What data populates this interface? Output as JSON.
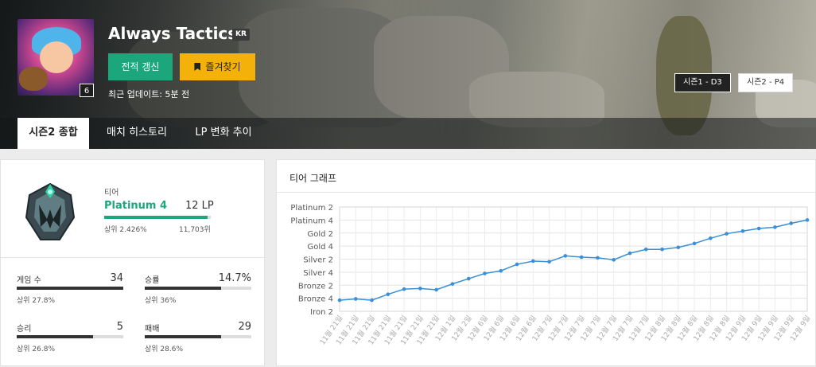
{
  "header": {
    "summoner_name": "Always Tactics",
    "region": "KR",
    "level": "6",
    "refresh_label": "전적 갱신",
    "favorite_label": "즐겨찾기",
    "last_update": "최근 업데이트: 5분 전",
    "season_chips": [
      "시즌1 - D3",
      "시즌2 - P4"
    ]
  },
  "tabs": [
    {
      "label": "시즌2 종합",
      "active": true
    },
    {
      "label": "매치 히스토리",
      "active": false
    },
    {
      "label": "LP 변화 추이",
      "active": false
    }
  ],
  "rank": {
    "heading": "티어",
    "tier": "Platinum 4",
    "lp": "12 LP",
    "lp_progress": 0.97,
    "rank_pct": "상위 2.426%",
    "rank_num": "11,703위",
    "stats": [
      {
        "label": "게임 수",
        "value": "34",
        "sub": "상위 27.8%",
        "fill": 1.0
      },
      {
        "label": "승률",
        "value": "14.7%",
        "sub": "상위 36%",
        "fill": 0.72
      },
      {
        "label": "승리",
        "value": "5",
        "sub": "상위 26.8%",
        "fill": 0.72
      },
      {
        "label": "패배",
        "value": "29",
        "sub": "상위 28.6%",
        "fill": 0.72
      }
    ]
  },
  "graph": {
    "title": "티어 그래프"
  },
  "colors": {
    "accent_green": "#1ba67c",
    "favorite_yellow": "#f3b10a",
    "line_blue": "#3a8fd6"
  },
  "chart_data": {
    "type": "line",
    "y_tick_labels": [
      "Iron 2",
      "Bronze 4",
      "Bronze 2",
      "Silver 4",
      "Silver 2",
      "Gold 4",
      "Gold 2",
      "Platinum 4",
      "Platinum 2"
    ],
    "x": [
      "11월 21일",
      "11월 21일",
      "11월 21일",
      "11월 21일",
      "11월 21일",
      "11월 21일",
      "11월 21일",
      "12월 1일",
      "12월 2일",
      "12월 6일",
      "12월 6일",
      "12월 6일",
      "12월 6일",
      "12월 7일",
      "12월 7일",
      "12월 7일",
      "12월 7일",
      "12월 7일",
      "12월 7일",
      "12월 7일",
      "12월 8일",
      "12월 8일",
      "12월 8일",
      "12월 8일",
      "12월 8일",
      "12월 9일",
      "12월 9일",
      "12월 9일",
      "12월 9일",
      "12월 9일"
    ],
    "values": [
      0.85,
      0.95,
      0.85,
      1.3,
      1.7,
      1.75,
      1.65,
      2.1,
      2.5,
      2.9,
      3.1,
      3.6,
      3.85,
      3.8,
      4.25,
      4.15,
      4.1,
      3.95,
      4.45,
      4.75,
      4.75,
      4.9,
      5.2,
      5.6,
      5.95,
      6.15,
      6.35,
      6.45,
      6.75,
      7.0
    ],
    "ylim": [
      0,
      8
    ],
    "grid": true,
    "xlabel": "",
    "ylabel": ""
  }
}
